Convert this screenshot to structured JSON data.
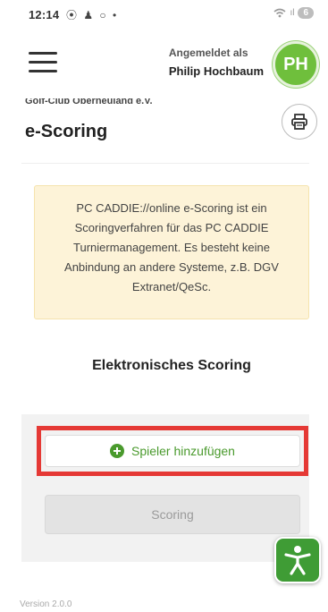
{
  "status_bar": {
    "time": "12:14",
    "left_icons": "⦿ ♟ ○ •",
    "network": "ıl",
    "battery": "6"
  },
  "header": {
    "login_label": "Angemeldet als",
    "user_name": "Philip Hochbaum",
    "avatar_initials": "PH",
    "avatar_color": "#6fbf3c"
  },
  "page": {
    "club_name": "Golf-Club Oberneuland e.V.",
    "title": "e-Scoring",
    "print_icon": "printer-icon"
  },
  "info_box": {
    "text": "PC CADDIE://online e-Scoring ist ein Scoringverfahren für das PC CADDIE Turniermanagement. Es besteht keine Anbindung an andere Systeme, z.B. DGV Extranet/QeSc.",
    "background": "#fdf3d8"
  },
  "scoring_section": {
    "title": "Elektronisches Scoring",
    "add_player_label": "Spieler hinzufügen",
    "scoring_label": "Scoring",
    "accent_color": "#4a9a2d",
    "highlight_color": "#e53935"
  },
  "accessibility": {
    "icon": "accessibility-icon",
    "color": "#3f9c35"
  },
  "footer": {
    "version": "Version 2.0.0"
  }
}
